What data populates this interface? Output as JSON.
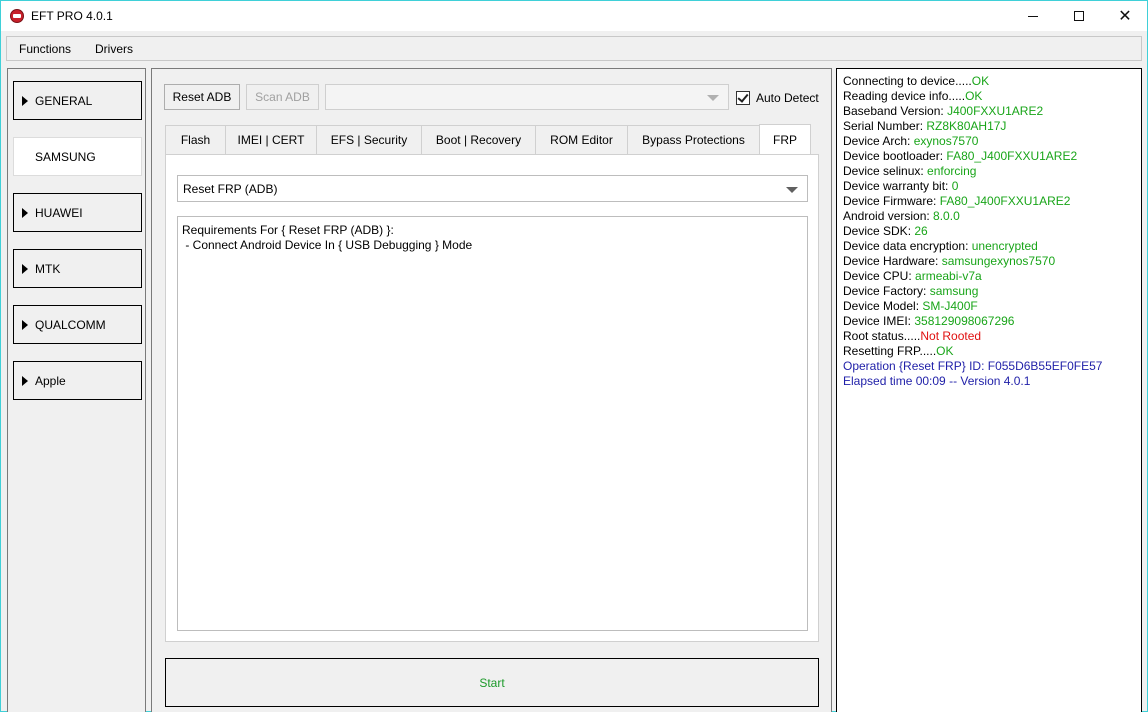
{
  "window": {
    "title": "EFT PRO 4.0.1",
    "controls": {
      "minimize": "minimize-icon",
      "maximize": "maximize-icon",
      "close": "close-icon"
    }
  },
  "menu": {
    "items": [
      "Functions",
      "Drivers"
    ]
  },
  "sidebar": {
    "items": [
      {
        "label": "GENERAL",
        "active": false
      },
      {
        "label": "SAMSUNG",
        "active": true
      },
      {
        "label": "HUAWEI",
        "active": false
      },
      {
        "label": "MTK",
        "active": false
      },
      {
        "label": "QUALCOMM",
        "active": false
      },
      {
        "label": "Apple",
        "active": false
      }
    ]
  },
  "toolbar": {
    "reset_adb": "Reset ADB",
    "scan_adb": "Scan ADB",
    "device_combo_value": "",
    "auto_detect_label": "Auto Detect",
    "auto_detect_checked": true
  },
  "tabs": [
    {
      "label": "Flash"
    },
    {
      "label": "IMEI | CERT"
    },
    {
      "label": "EFS | Security"
    },
    {
      "label": "Boot | Recovery"
    },
    {
      "label": "ROM Editor"
    },
    {
      "label": "Bypass Protections"
    },
    {
      "label": "FRP",
      "active": true
    }
  ],
  "frp": {
    "operation_selected": "Reset FRP (ADB)",
    "requirements_title": "Requirements For { Reset FRP (ADB) }:",
    "requirements_line1": " - Connect Android Device In { USB Debugging } Mode"
  },
  "start_button": "Start",
  "log": [
    {
      "label": "Connecting to device.....",
      "value": "OK",
      "style": "ok"
    },
    {
      "label": "Reading device info.....",
      "value": "OK",
      "style": "ok"
    },
    {
      "label": "Baseband Version: ",
      "value": "J400FXXU1ARE2",
      "style": "ok"
    },
    {
      "label": "Serial Number: ",
      "value": "RZ8K80AH17J",
      "style": "ok"
    },
    {
      "label": "Device Arch: ",
      "value": "exynos7570",
      "style": "ok"
    },
    {
      "label": "Device bootloader: ",
      "value": "FA80_J400FXXU1ARE2",
      "style": "ok"
    },
    {
      "label": "Device selinux: ",
      "value": "enforcing",
      "style": "ok"
    },
    {
      "label": "Device warranty bit: ",
      "value": "0",
      "style": "ok"
    },
    {
      "label": "Device Firmware: ",
      "value": "FA80_J400FXXU1ARE2",
      "style": "ok"
    },
    {
      "label": "Android version: ",
      "value": "8.0.0",
      "style": "ok"
    },
    {
      "label": "Device SDK: ",
      "value": "26",
      "style": "ok"
    },
    {
      "label": "Device data encryption: ",
      "value": "unencrypted",
      "style": "ok"
    },
    {
      "label": "Device Hardware: ",
      "value": "samsungexynos7570",
      "style": "ok"
    },
    {
      "label": "Device CPU: ",
      "value": "armeabi-v7a",
      "style": "ok"
    },
    {
      "label": "Device Factory: ",
      "value": "samsung",
      "style": "ok"
    },
    {
      "label": "Device Model: ",
      "value": "SM-J400F",
      "style": "ok"
    },
    {
      "label": "Device IMEI: ",
      "value": "358129098067296",
      "style": "ok"
    },
    {
      "label": "Root status.....",
      "value": "Not Rooted",
      "style": "err"
    },
    {
      "label": "Resetting FRP.....",
      "value": "OK",
      "style": "ok"
    },
    {
      "label": "Operation {Reset FRP} ID: F055D6B55EF0FE57",
      "value": "",
      "style": "blue"
    },
    {
      "label": "Elapsed time 00:09 -- Version 4.0.1",
      "value": "",
      "style": "blue"
    }
  ],
  "colors": {
    "ok": "#19a519",
    "error": "#e01010",
    "info": "#1f1fa8",
    "start_text": "#1c9a2a"
  }
}
